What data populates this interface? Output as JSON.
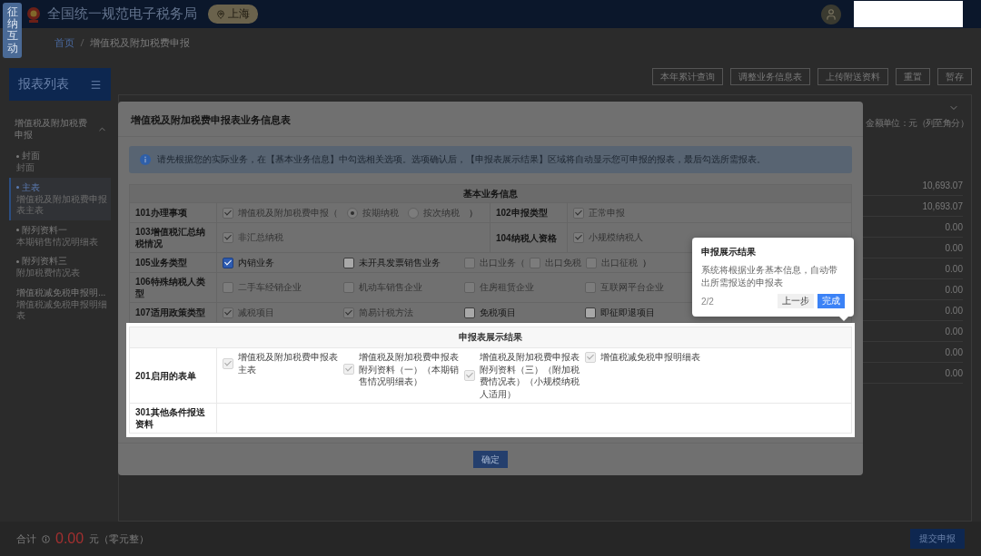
{
  "floating_tab": {
    "label": "征纳互动"
  },
  "header": {
    "title": "全国统一规范电子税务局",
    "region": "上海"
  },
  "breadcrumb": [
    "首页",
    "增值税及附加税费申报"
  ],
  "sidebar": {
    "title": "报表列表",
    "group": {
      "label": "增值税及附加税费申报",
      "expanded": true,
      "children": [
        {
          "label": "封面",
          "note": "封面",
          "bullet": true,
          "selected": false
        },
        {
          "label": "主表",
          "note": "增值税及附加税费申报表主表",
          "bullet": true,
          "selected": true
        },
        {
          "label": "附列资料一",
          "note": "本期销售情况明细表",
          "bullet": true,
          "selected": false
        },
        {
          "label": "附列资料三",
          "note": "附加税费情况表",
          "bullet": true,
          "selected": false
        },
        {
          "label": "增值税减免税申报明...",
          "note": "增值税减免税申报明细表",
          "bullet": false,
          "selected": false
        }
      ]
    }
  },
  "toolbar": [
    "本年累计查询",
    "调整业务信息表",
    "上传附送资料",
    "重置",
    "暂存"
  ],
  "report": {
    "unit": "金额单位：元（列至角分）",
    "expanded": false,
    "values": [
      "10,693.07",
      "10,693.07",
      "0.00",
      "0.00",
      "0.00",
      "0.00",
      "0.00",
      "0.00",
      "0.00",
      "0.00"
    ]
  },
  "footer": {
    "total_label": "合计",
    "total": "0.00",
    "total_words": "元（零元整）",
    "submit": "提交申报"
  },
  "modal": {
    "title": "增值税及附加税费申报表业务信息表",
    "notice": "请先根据您的实际业务，在【基本业务信息】中勾选相关选项。选项确认后，【申报表展示结果】区域将自动显示您可申报的报表，最后勾选所需报表。",
    "basic": {
      "heading": "基本业务信息",
      "rows": [
        {
          "label": "101办理事项",
          "options": [
            {
              "kind": "checkbox",
              "label": "增值税及附加税费申报（",
              "checked": true,
              "disabled": true
            },
            {
              "kind": "radio",
              "label": "按期纳税",
              "selected": true,
              "disabled": true
            },
            {
              "kind": "radio",
              "label": "按次纳税",
              "selected": false,
              "disabled": true
            },
            {
              "kind": "text",
              "label": "）"
            }
          ],
          "side": {
            "label": "102申报类型",
            "options": [
              {
                "kind": "checkbox",
                "label": "正常申报",
                "checked": true,
                "disabled": true
              }
            ]
          }
        },
        {
          "label": "103增值税汇总纳税情况",
          "options": [
            {
              "kind": "checkbox",
              "label": "非汇总纳税",
              "checked": true,
              "disabled": true
            }
          ],
          "side": {
            "label": "104纳税人资格",
            "options": [
              {
                "kind": "checkbox",
                "label": "小规模纳税人",
                "checked": true,
                "disabled": true
              }
            ]
          }
        },
        {
          "label": "105业务类型",
          "options": [
            {
              "kind": "checkbox",
              "label": "内销业务",
              "checked": true,
              "disabled": false
            },
            {
              "kind": "checkbox",
              "label": "未开具发票销售业务",
              "checked": false,
              "disabled": false
            },
            {
              "kind": "checkbox",
              "label": "出口业务（",
              "checked": false,
              "disabled": true,
              "children": [
                {
                  "kind": "checkbox",
                  "label": "出口免税",
                  "checked": false,
                  "disabled": true
                },
                {
                  "kind": "checkbox",
                  "label": "出口征税",
                  "checked": false,
                  "disabled": true
                },
                {
                  "kind": "text",
                  "label": "）"
                }
              ]
            }
          ]
        },
        {
          "label": "106特殊纳税人类型",
          "options": [
            {
              "kind": "checkbox",
              "label": "二手车经销企业",
              "checked": false,
              "disabled": true
            },
            {
              "kind": "checkbox",
              "label": "机动车销售企业",
              "checked": false,
              "disabled": true
            },
            {
              "kind": "checkbox",
              "label": "住房租赁企业",
              "checked": false,
              "disabled": true
            },
            {
              "kind": "checkbox",
              "label": "互联网平台企业",
              "checked": false,
              "disabled": true
            }
          ]
        },
        {
          "label": "107适用政策类型",
          "options": [
            {
              "kind": "checkbox",
              "label": "减税项目",
              "checked": true,
              "disabled": true
            },
            {
              "kind": "checkbox",
              "label": "简易计税方法",
              "checked": true,
              "disabled": true
            },
            {
              "kind": "checkbox",
              "label": "免税项目",
              "checked": false,
              "disabled": false
            },
            {
              "kind": "checkbox",
              "label": "即征即退项目",
              "checked": false,
              "disabled": false
            }
          ]
        }
      ]
    },
    "result": {
      "heading": "申报表展示结果",
      "rows": [
        {
          "label": "201启用的表单",
          "options": [
            {
              "kind": "checkbox",
              "label": "增值税及附加税费申报表主表",
              "checked": true,
              "disabled": true
            },
            {
              "kind": "checkbox",
              "label": "增值税及附加税费申报表附列资料（一）（本期销售情况明细表）",
              "checked": true,
              "disabled": true
            },
            {
              "kind": "checkbox",
              "label": "增值税及附加税费申报表附列资料（三）（附加税费情况表）（小规模纳税人适用）",
              "checked": true,
              "disabled": true
            },
            {
              "kind": "checkbox",
              "label": "增值税减免税申报明细表",
              "checked": true,
              "disabled": true
            }
          ]
        },
        {
          "label": "301其他条件报送资料"
        }
      ]
    },
    "confirm": "确定"
  },
  "tour": {
    "title": "申报展示结果",
    "text": "系统将根据业务基本信息，自动带出所需报送的申报表",
    "step": "2/2",
    "prev": "上一步",
    "done": "完成"
  }
}
